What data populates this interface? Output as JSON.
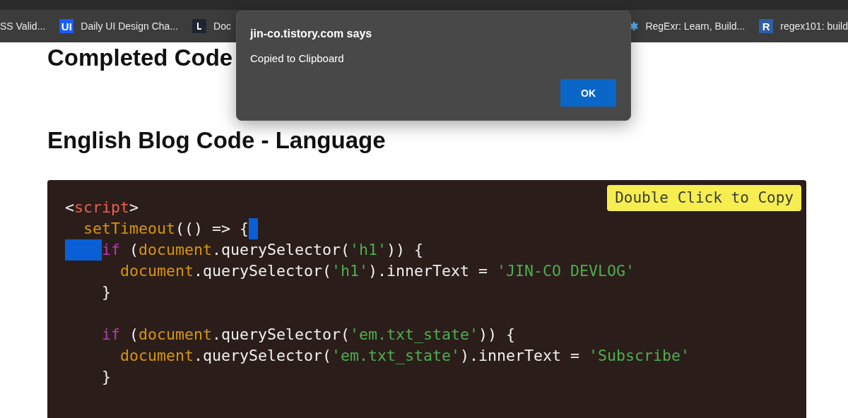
{
  "bookmarks": [
    {
      "label": "SS Valid...",
      "kind": "none"
    },
    {
      "label": "Daily UI Design Cha...",
      "kind": "letters",
      "icon_text": "UI",
      "color": "#1a5cff"
    },
    {
      "label": "Doc",
      "kind": "mark"
    },
    {
      "label": "RegExr: Learn, Build...",
      "kind": "star"
    },
    {
      "label": "regex101: build",
      "kind": "letters",
      "icon_text": "R",
      "color": "#2f5ea8"
    }
  ],
  "headings": [
    "Completed Code",
    "English Blog Code - Language"
  ],
  "code_block": {
    "badge": "Double Click to Copy",
    "lines": [
      {
        "tokens": [
          {
            "kind": "plain",
            "text": "<"
          },
          {
            "kind": "tag",
            "text": "script"
          },
          {
            "kind": "plain",
            "text": ">"
          }
        ]
      },
      {
        "selected_eol": true,
        "tokens": [
          {
            "kind": "function",
            "text": "  setTimeout"
          },
          {
            "kind": "plain",
            "text": "(() => {"
          }
        ]
      },
      {
        "selected_indent": true,
        "tokens": [
          {
            "kind": "keyword",
            "text": "    if"
          },
          {
            "kind": "plain",
            "text": " ("
          },
          {
            "kind": "function",
            "text": "document"
          },
          {
            "kind": "plain",
            "text": ".querySelector("
          },
          {
            "kind": "string",
            "text": "'h1'"
          },
          {
            "kind": "plain",
            "text": ")) {"
          }
        ]
      },
      {
        "tokens": [
          {
            "kind": "function",
            "text": "      document"
          },
          {
            "kind": "plain",
            "text": ".querySelector("
          },
          {
            "kind": "string",
            "text": "'h1'"
          },
          {
            "kind": "plain",
            "text": ").innerText = "
          },
          {
            "kind": "string",
            "text": "'JIN-CO DEVLOG'"
          }
        ]
      },
      {
        "blank_after": true,
        "tokens": [
          {
            "kind": "plain",
            "text": "    }"
          }
        ]
      },
      {
        "tokens": [
          {
            "kind": "keyword",
            "text": "    if"
          },
          {
            "kind": "plain",
            "text": " ("
          },
          {
            "kind": "function",
            "text": "document"
          },
          {
            "kind": "plain",
            "text": ".querySelector("
          },
          {
            "kind": "string",
            "text": "'em.txt_state'"
          },
          {
            "kind": "plain",
            "text": ")) {"
          }
        ]
      },
      {
        "tokens": [
          {
            "kind": "function",
            "text": "      document"
          },
          {
            "kind": "plain",
            "text": ".querySelector("
          },
          {
            "kind": "string",
            "text": "'em.txt_state'"
          },
          {
            "kind": "plain",
            "text": ").innerText = "
          },
          {
            "kind": "string",
            "text": "'Subscribe'"
          }
        ]
      },
      {
        "blank_after": true,
        "tokens": [
          {
            "kind": "plain",
            "text": "    }"
          }
        ]
      }
    ]
  },
  "dialog": {
    "title": "jin-co.tistory.com says",
    "message": "Copied to Clipboard",
    "button": "OK"
  }
}
